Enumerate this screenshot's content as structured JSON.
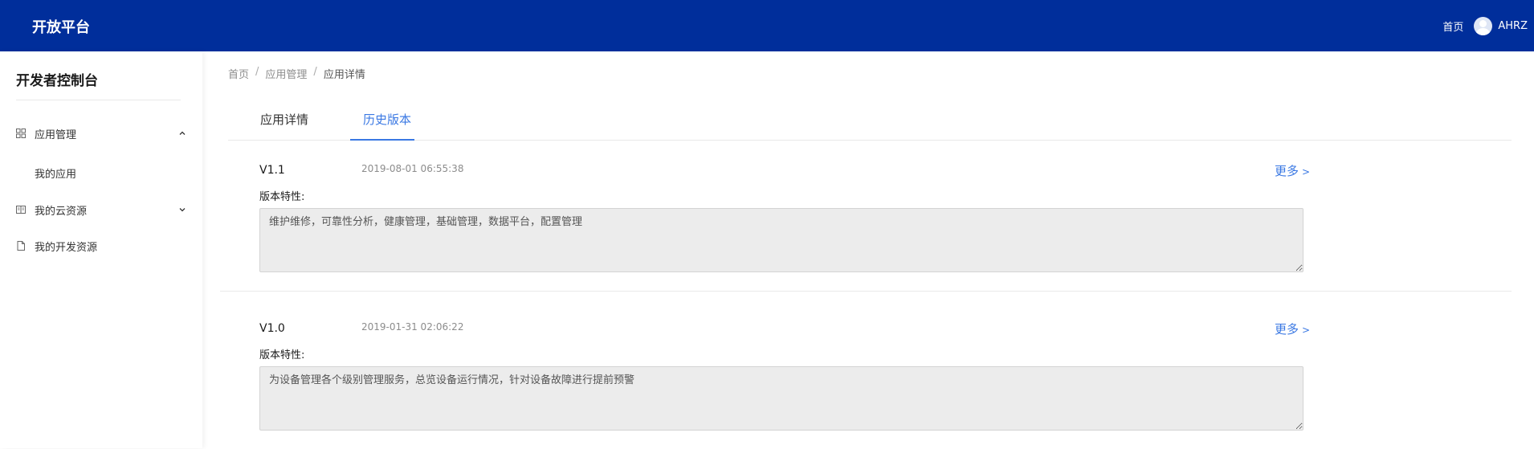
{
  "header": {
    "brand": "开放平台",
    "home_link": "首页",
    "username": "AHRZ"
  },
  "sidebar": {
    "title": "开发者控制台",
    "items": [
      {
        "label": "应用管理",
        "icon": "grid-icon",
        "expanded": true,
        "children": [
          {
            "label": "我的应用"
          }
        ]
      },
      {
        "label": "我的云资源",
        "icon": "book-icon",
        "expanded": false
      },
      {
        "label": "我的开发资源",
        "icon": "file-icon"
      }
    ]
  },
  "breadcrumb": [
    "首页",
    "应用管理",
    "应用详情"
  ],
  "tabs": [
    {
      "label": "应用详情",
      "active": false
    },
    {
      "label": "历史版本",
      "active": true
    }
  ],
  "versions": [
    {
      "name": "V1.1",
      "date": "2019-08-01 06:55:38",
      "more": "更多",
      "feature_label": "版本特性:",
      "features": "维护维修，可靠性分析，健康管理，基础管理，数据平台，配置管理"
    },
    {
      "name": "V1.0",
      "date": "2019-01-31 02:06:22",
      "more": "更多",
      "feature_label": "版本特性:",
      "features": "为设备管理各个级别管理服务，总览设备运行情况，针对设备故障进行提前预警"
    }
  ],
  "colors": {
    "header_bg": "#002e9b",
    "accent": "#3a78e3"
  }
}
